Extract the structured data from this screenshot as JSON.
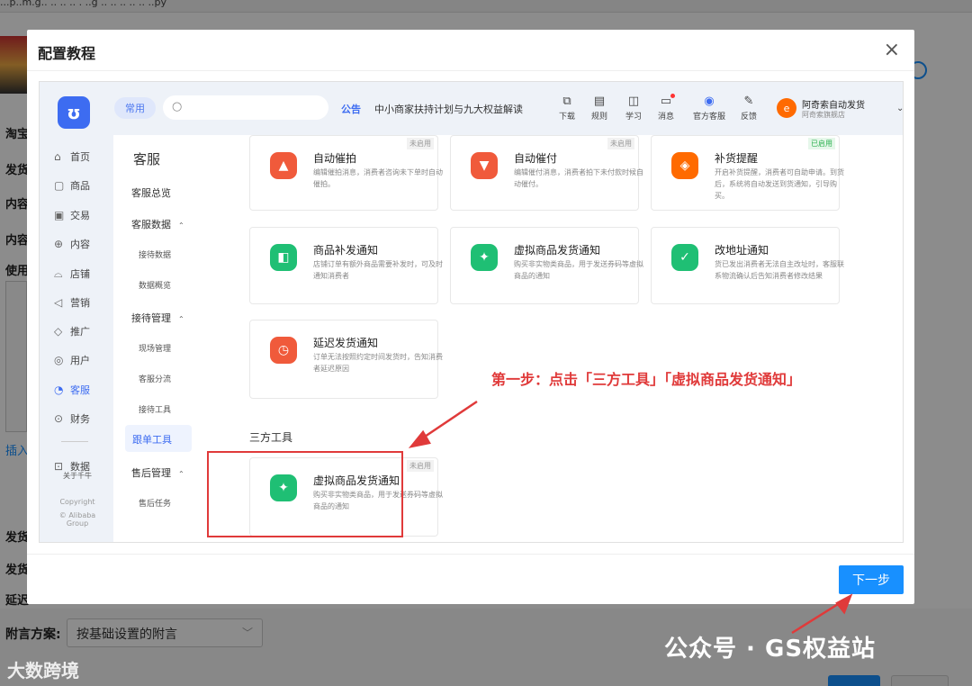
{
  "background": {
    "url_text": "...p..m.g..  ..  .. ..  .  ..g  .. .. .. ..  ..  ..py",
    "side_labels": [
      "淘宝",
      "发货",
      "内容",
      "内容",
      "使用",
      "插入",
      "发货",
      "发货",
      "延迟"
    ],
    "attach_label": "附言方案:",
    "attach_select": "按基础设置的附言"
  },
  "modal": {
    "title": "配置教程",
    "close": "×",
    "next_button": "下一步"
  },
  "shot": {
    "logo_char": "ʊ",
    "common_chip": "常用",
    "notice_tag": "公告",
    "notice_text": "中小商家扶持计划与九大权益解读",
    "tools": [
      {
        "label": "下载",
        "icon": "download-icon",
        "glyph": "⧉"
      },
      {
        "label": "规则",
        "icon": "rules-icon",
        "glyph": "▤"
      },
      {
        "label": "学习",
        "icon": "learn-icon",
        "glyph": "◫"
      },
      {
        "label": "消息",
        "icon": "message-icon",
        "glyph": "▭"
      },
      {
        "label": "官方客服",
        "icon": "service-icon",
        "glyph": "◉"
      },
      {
        "label": "反馈",
        "icon": "feedback-icon",
        "glyph": "✎"
      }
    ],
    "shop_avatar": "e",
    "shop_name": "阿奇索自动发货",
    "shop_sub": "阿奇索旗舰店",
    "left_nav": [
      {
        "label": "首页",
        "glyph": "⌂"
      },
      {
        "label": "商品",
        "glyph": "▢"
      },
      {
        "label": "交易",
        "glyph": "▣"
      },
      {
        "label": "内容",
        "glyph": "⊕"
      },
      {
        "label": "店铺",
        "glyph": "⌓"
      },
      {
        "label": "营销",
        "glyph": "◁"
      },
      {
        "label": "推广",
        "glyph": "◇"
      },
      {
        "label": "用户",
        "glyph": "◎"
      },
      {
        "label": "客服",
        "glyph": "◔"
      },
      {
        "label": "财务",
        "glyph": "⊙"
      }
    ],
    "data_label": "数据",
    "about": "关于千牛",
    "copyright": "Copyright",
    "alibaba": "© Alibaba Group",
    "subnav": {
      "title": "客服",
      "overview": "客服总览",
      "group1": "客服数据",
      "g1_items": [
        "接待数据",
        "数据概览"
      ],
      "group2": "接待管理",
      "g2_items": [
        "现场管理",
        "客服分流",
        "接待工具"
      ],
      "active": "跟单工具",
      "group3": "售后管理",
      "g3_items": [
        "售后任务"
      ]
    },
    "cards": [
      {
        "title": "自动催拍",
        "desc": "编辑催拍消息，消费者咨询未下单时自动催拍。",
        "badge": "未启用",
        "color": "red",
        "glyph": "▲"
      },
      {
        "title": "自动催付",
        "desc": "编辑催付消息，消费者拍下未付款时候自动催付。",
        "badge": "未启用",
        "color": "red",
        "glyph": "▼"
      },
      {
        "title": "补货提醒",
        "desc": "开启补货提醒，消费者可自助申请。到货后，系统将自动发送到货通知，引导购买。",
        "badge": "已启用",
        "color": "orange",
        "glyph": "◈"
      },
      {
        "title": "商品补发通知",
        "desc": "店铺订单有额外商品需要补发时，可及时通知消费者",
        "badge": "",
        "color": "green",
        "glyph": "◧"
      },
      {
        "title": "虚拟商品发货通知",
        "desc": "购买非实物类商品，用于发送券码等虚拟商品的通知",
        "badge": "",
        "color": "green",
        "glyph": "✦"
      },
      {
        "title": "改地址通知",
        "desc": "货已发出消费者无法自主改址时，客服联系物流确认后告知消费者修改结果",
        "badge": "",
        "color": "green",
        "glyph": "✓"
      },
      {
        "title": "延迟发货通知",
        "desc": "订单无法按照约定时间发货时，告知消费者延迟原因",
        "badge": "",
        "color": "red",
        "glyph": "◷"
      }
    ],
    "section_title": "三方工具",
    "third_card": {
      "title": "虚拟商品发货通知",
      "desc": "购买非实物类商品，用于发送券码等虚拟商品的通知",
      "badge": "未启用",
      "color": "green",
      "glyph": "✦"
    }
  },
  "annotation": {
    "step_text": "第一步：点击「三方工具」「虚拟商品发货通知」",
    "arrow_color": "#e03a3a"
  },
  "watermarks": {
    "wechat": "公众号 · GS权益站",
    "brand": "大数跨境"
  }
}
